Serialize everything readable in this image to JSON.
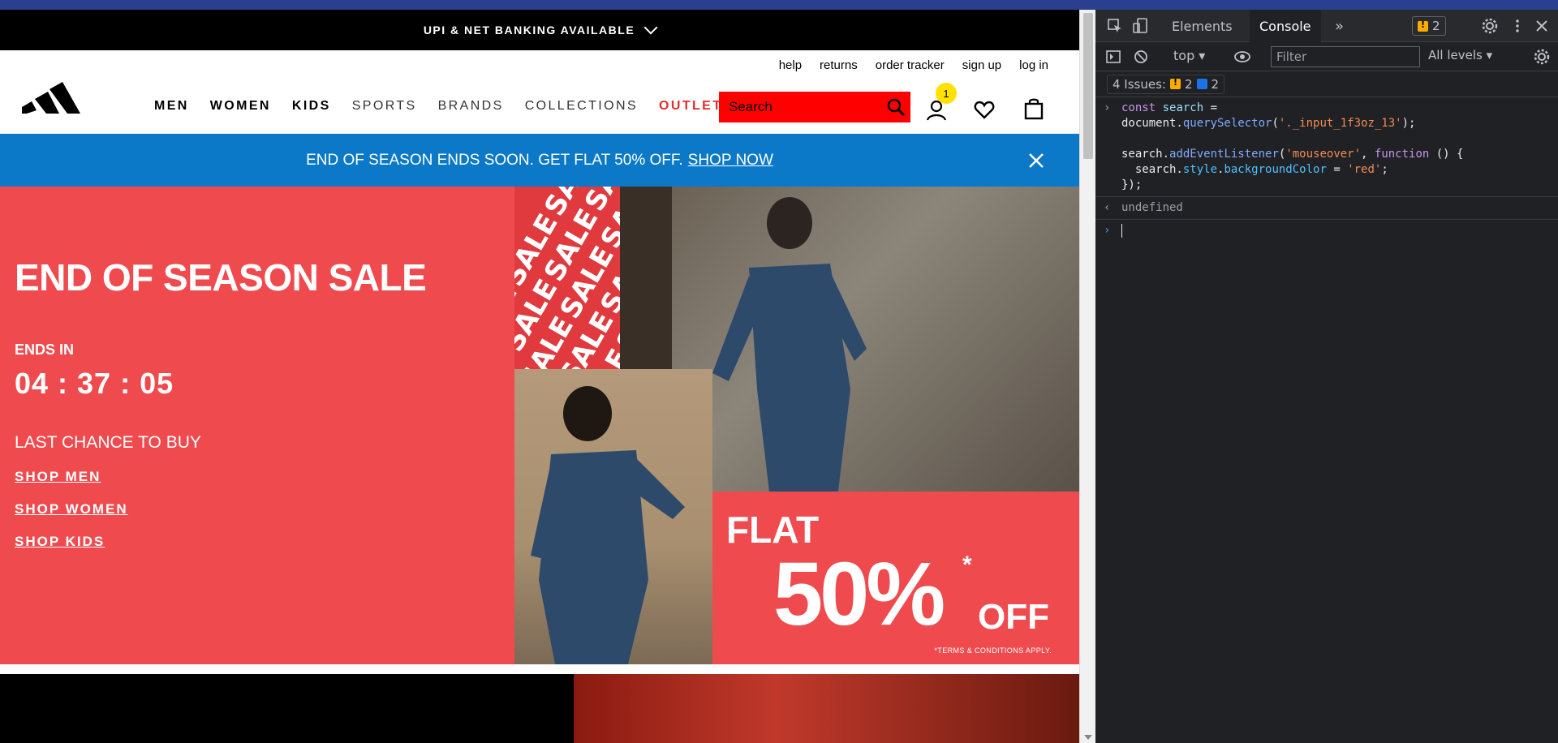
{
  "promo_bar": {
    "text": "UPI & NET BANKING AVAILABLE"
  },
  "header": {
    "util_links": [
      "help",
      "returns",
      "order tracker",
      "sign up",
      "log in"
    ],
    "nav": [
      {
        "label": "MEN",
        "style": "bold"
      },
      {
        "label": "WOMEN",
        "style": "bold"
      },
      {
        "label": "KIDS",
        "style": "bold"
      },
      {
        "label": "SPORTS",
        "style": "light"
      },
      {
        "label": "BRANDS",
        "style": "light"
      },
      {
        "label": "COLLECTIONS",
        "style": "light"
      },
      {
        "label": "OUTLET",
        "style": "outlet"
      }
    ],
    "search_placeholder": "Search",
    "cart_count": "1"
  },
  "banner": {
    "text": "END OF SEASON ENDS SOON. GET FLAT 50% OFF.",
    "link": "SHOP NOW"
  },
  "hero": {
    "title": "END OF SEASON SALE",
    "ends_label": "ENDS IN",
    "countdown": "04 : 37 : 05",
    "last_chance": "LAST CHANCE TO BUY",
    "links": [
      "SHOP MEN",
      "SHOP WOMEN",
      "SHOP KIDS"
    ],
    "pattern_word": "SALE",
    "flat": "FLAT",
    "percent": "50%",
    "star": "*",
    "off": "OFF",
    "terms": "*TERMS & CONDITIONS APPLY."
  },
  "devtools": {
    "tabs": [
      "Elements",
      "Console"
    ],
    "active_tab": "Console",
    "more": "»",
    "issue_badge_count": "2",
    "context": "top",
    "filter_placeholder": "Filter",
    "levels": "All levels",
    "issues_label": "4 Issues:",
    "issues_warn": "2",
    "issues_info": "2",
    "result": "undefined"
  },
  "colors": {
    "hero_red": "#ef4b4f",
    "banner_blue": "#0b79c7",
    "search_red": "#ff0000",
    "outlet_red": "#e32b2b",
    "badge_yellow": "#ffe100"
  }
}
